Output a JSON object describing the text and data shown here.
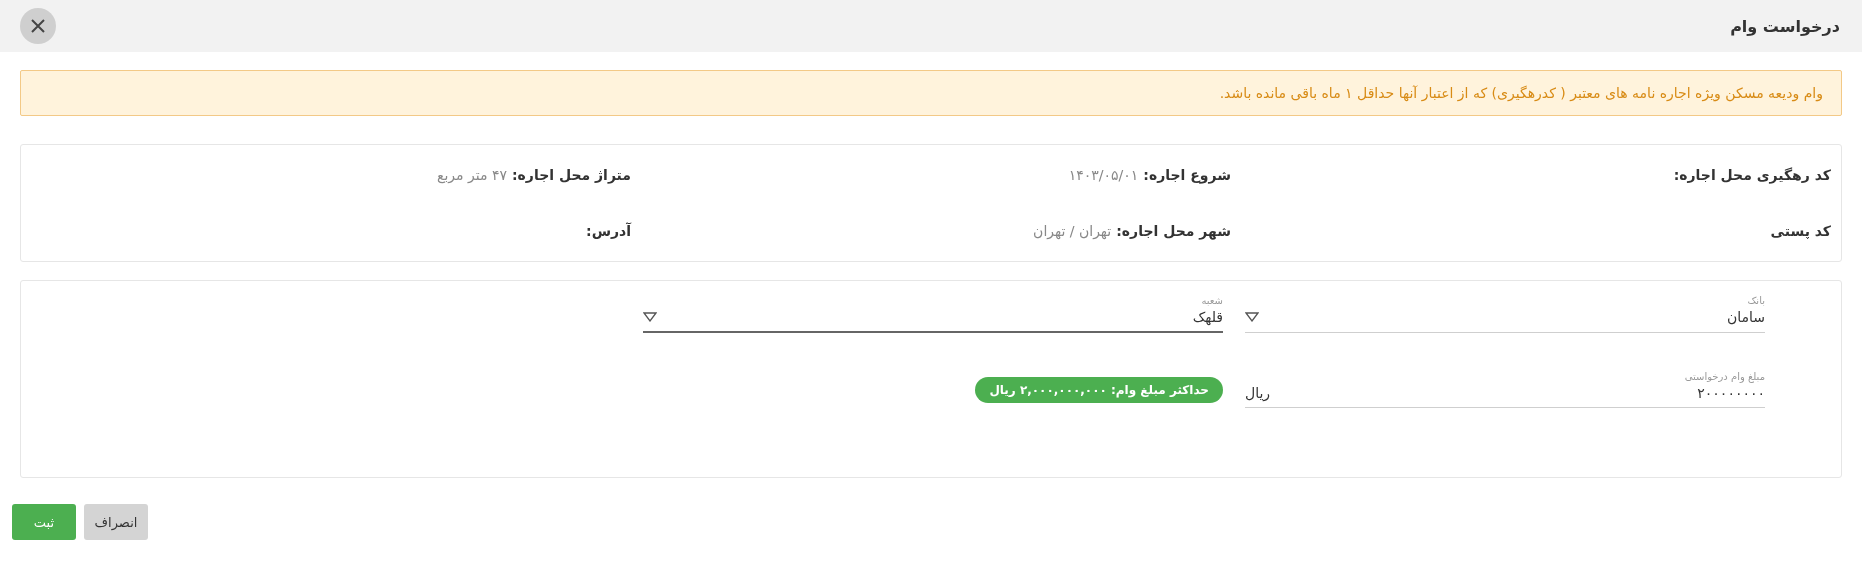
{
  "dialog": {
    "title": "درخواست وام"
  },
  "alert": {
    "text": "وام ودیعه مسکن ویژه اجاره نامه های معتبر ( کدرهگیری) که از اعتبار آنها حداقل ۱ ماه باقی مانده باشد."
  },
  "info": [
    {
      "label": "کد رهگیری محل اجاره:"
    },
    {
      "label": "شروع اجاره:",
      "value": "۱۴۰۳/۰۵/۰۱"
    },
    {
      "label": "متراژ محل اجاره:",
      "value": "۴۷ متر مربع"
    },
    {
      "label": "کد پستی"
    },
    {
      "label": "شهر محل اجاره:",
      "value": "تهران / تهران"
    },
    {
      "label": "آدرس:"
    }
  ],
  "fields": [
    {
      "kind": "select",
      "label": "بانک",
      "value": "سامان",
      "focused": false
    },
    {
      "kind": "select",
      "label": "شعبه",
      "value": "قلهک",
      "focused": true
    },
    {
      "kind": "text",
      "label": "مبلغ وام درخواستی",
      "value": "۲۰۰۰۰۰۰۰۰",
      "suffix": "ریال",
      "focused": false
    },
    {
      "kind": "badge",
      "text": "حداکثر مبلغ وام: ۲,۰۰۰,۰۰۰,۰۰۰ ریال"
    }
  ],
  "buttons": [
    {
      "label": "انصراف",
      "kind": "secondary"
    },
    {
      "label": "ثبت",
      "kind": "primary"
    }
  ]
}
